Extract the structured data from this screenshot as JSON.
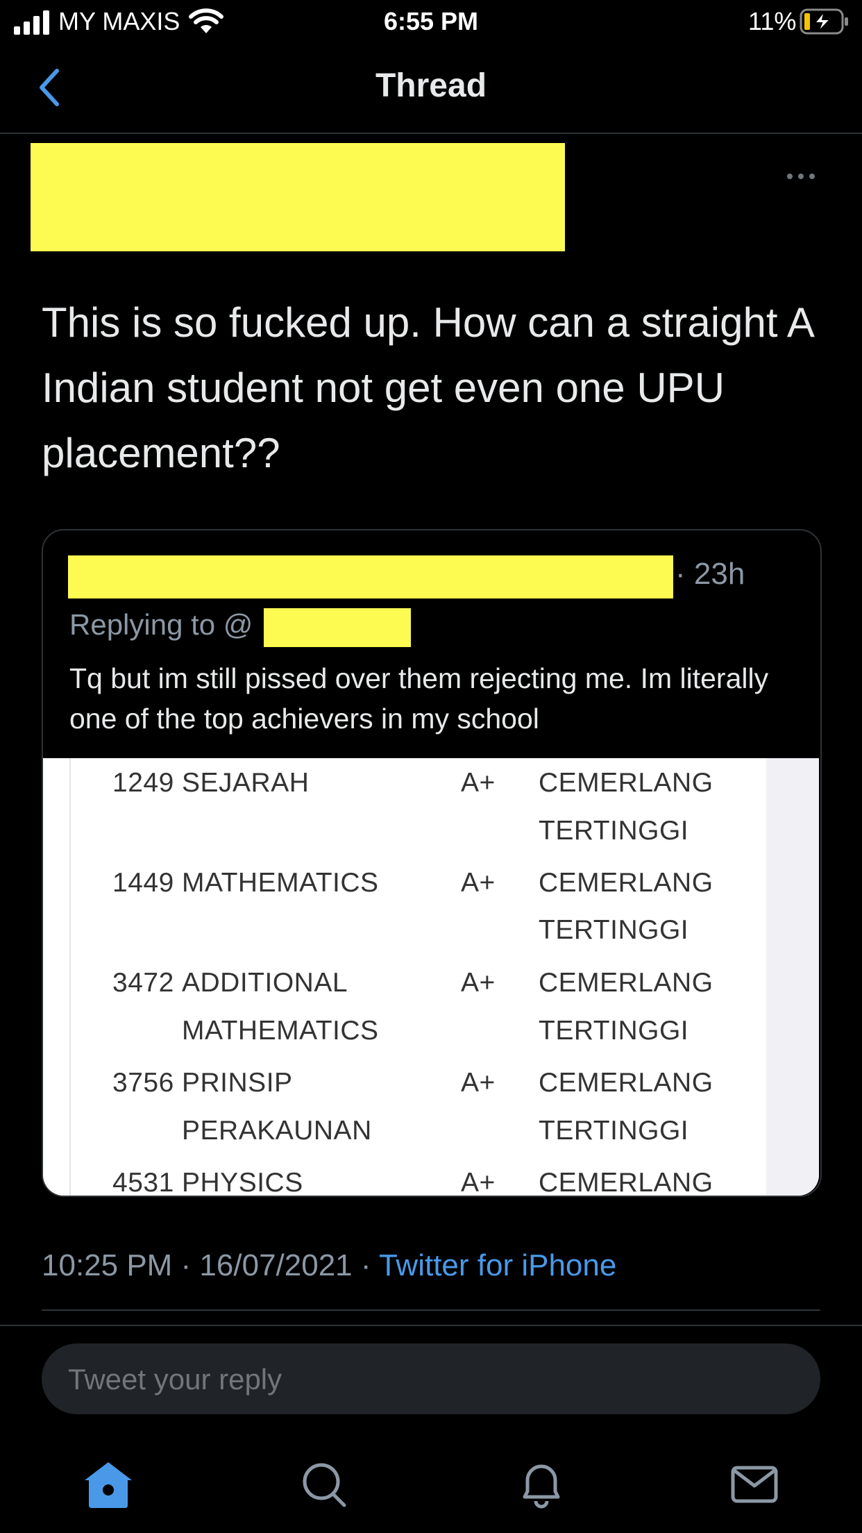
{
  "status_bar": {
    "carrier": "MY MAXIS",
    "time": "6:55 PM",
    "battery": "11%"
  },
  "header": {
    "title": "Thread"
  },
  "tweet": {
    "text": "This is so fucked up. How can a straight A Indian student not get even one UPU placement??",
    "timestamp": "10:25 PM · 16/07/2021 · ",
    "source": "Twitter for iPhone"
  },
  "quoted_tweet": {
    "time": "· 23h",
    "replying_prefix": "Replying to @",
    "text": "Tq but im still pissed over them rejecting me. Im literally one of the top achievers in my school",
    "results": [
      {
        "code": "1249",
        "subject": [
          "SEJARAH"
        ],
        "grade": "A+",
        "remark": [
          "CEMERLANG",
          "TERTINGGI"
        ]
      },
      {
        "code": "1449",
        "subject": [
          "MATHEMATICS"
        ],
        "grade": "A+",
        "remark": [
          "CEMERLANG",
          "TERTINGGI"
        ]
      },
      {
        "code": "3472",
        "subject": [
          "ADDITIONAL",
          "MATHEMATICS"
        ],
        "grade": "A+",
        "remark": [
          "CEMERLANG",
          "TERTINGGI"
        ]
      },
      {
        "code": "3756",
        "subject": [
          "PRINSIP",
          "PERAKAUNAN"
        ],
        "grade": "A+",
        "remark": [
          "CEMERLANG",
          "TERTINGGI"
        ]
      },
      {
        "code": "4531",
        "subject": [
          "PHYSICS"
        ],
        "grade": "A+",
        "remark": [
          "CEMERLANG"
        ]
      }
    ]
  },
  "reply": {
    "placeholder": "Tweet your reply"
  },
  "colors": {
    "accent": "#4a99e9",
    "redaction": "#fdfb52",
    "background": "#000000"
  },
  "tab_bar": {
    "icons": [
      "home-icon",
      "search-icon",
      "notifications-icon",
      "messages-icon"
    ]
  }
}
